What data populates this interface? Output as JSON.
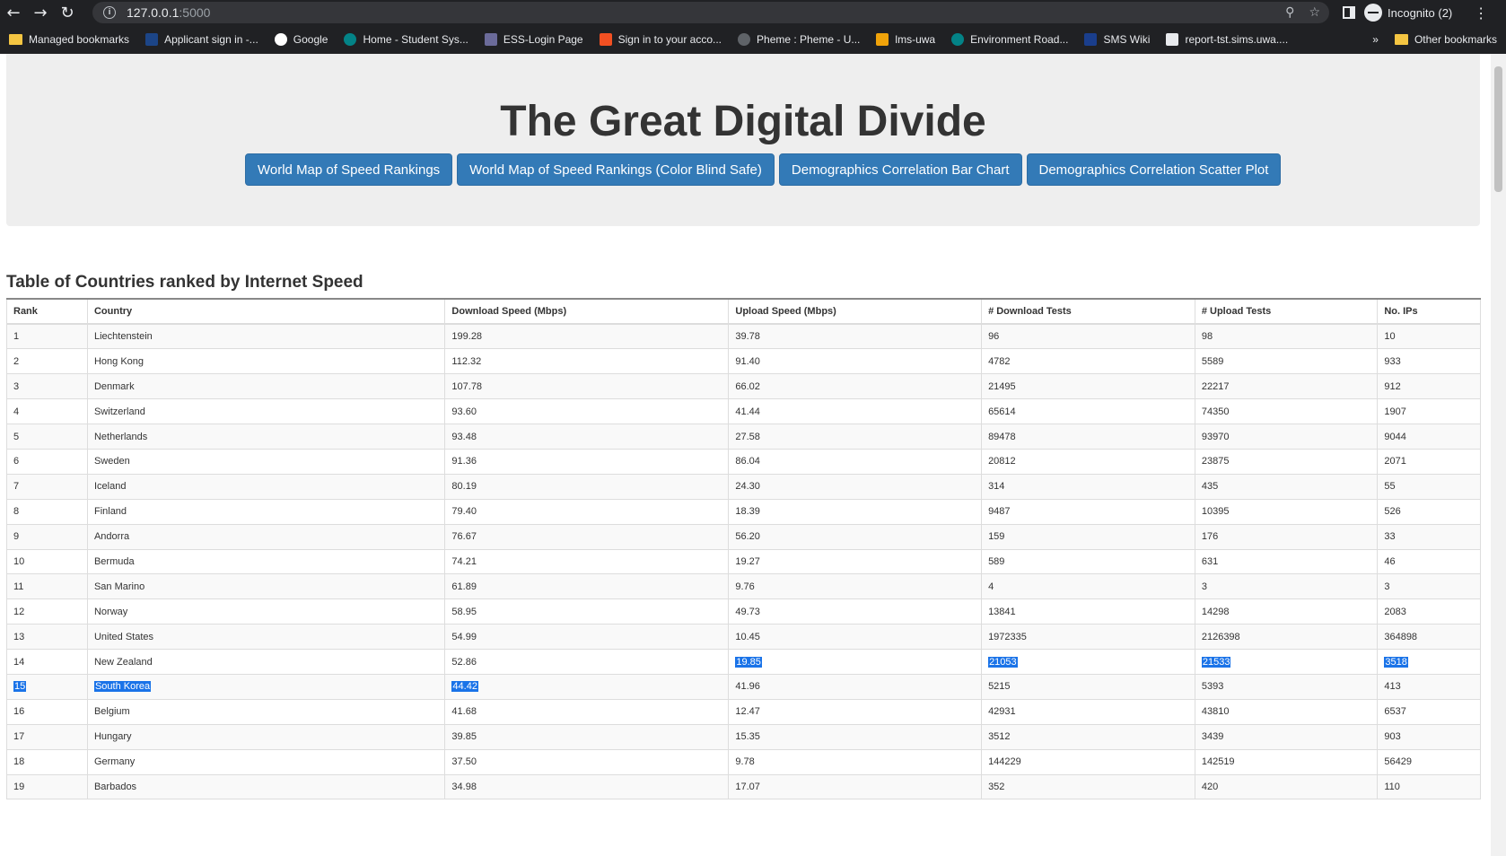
{
  "browser": {
    "url_host": "127.0.0.1",
    "url_port": ":5000",
    "profile_label": "Incognito (2)",
    "bookmarks": [
      {
        "label": "Managed bookmarks",
        "icon": "folder-icon",
        "color": "#f4c542"
      },
      {
        "label": "Applicant sign in -...",
        "icon": "applicant-icon",
        "color": "#1c4587"
      },
      {
        "label": "Google",
        "icon": "google-icon",
        "color": "#ffffff"
      },
      {
        "label": "Home - Student Sys...",
        "icon": "sharepoint-icon",
        "color": "#038387"
      },
      {
        "label": "ESS-Login Page",
        "icon": "ess-icon",
        "color": "#6b6b9a"
      },
      {
        "label": "Sign in to your acco...",
        "icon": "microsoft-icon",
        "color": "#f25022"
      },
      {
        "label": "Pheme : Pheme - U...",
        "icon": "pheme-icon",
        "color": "#5f6368"
      },
      {
        "label": "lms-uwa",
        "icon": "lms-icon",
        "color": "#f0a30a"
      },
      {
        "label": "Environment Road...",
        "icon": "sharepoint-icon",
        "color": "#038387"
      },
      {
        "label": "SMS Wiki",
        "icon": "wiki-icon",
        "color": "#1a3e8c"
      },
      {
        "label": "report-tst.sims.uwa....",
        "icon": "report-icon",
        "color": "#e8eaed"
      }
    ],
    "other_bookmarks": "Other bookmarks",
    "overflow_glyph": "»"
  },
  "header": {
    "title": "The Great Digital Divide",
    "buttons": [
      "World Map of Speed Rankings",
      "World Map of Speed Rankings (Color Blind Safe)",
      "Demographics Correlation Bar Chart",
      "Demographics Correlation Scatter Plot"
    ]
  },
  "table": {
    "caption": "Table of Countries ranked by Internet Speed",
    "columns": [
      "Rank",
      "Country",
      "Download Speed (Mbps)",
      "Upload Speed (Mbps)",
      "# Download Tests",
      "# Upload Tests",
      "No. IPs"
    ],
    "rows": [
      [
        "1",
        "Liechtenstein",
        "199.28",
        "39.78",
        "96",
        "98",
        "10"
      ],
      [
        "2",
        "Hong Kong",
        "112.32",
        "91.40",
        "4782",
        "5589",
        "933"
      ],
      [
        "3",
        "Denmark",
        "107.78",
        "66.02",
        "21495",
        "22217",
        "912"
      ],
      [
        "4",
        "Switzerland",
        "93.60",
        "41.44",
        "65614",
        "74350",
        "1907"
      ],
      [
        "5",
        "Netherlands",
        "93.48",
        "27.58",
        "89478",
        "93970",
        "9044"
      ],
      [
        "6",
        "Sweden",
        "91.36",
        "86.04",
        "20812",
        "23875",
        "2071"
      ],
      [
        "7",
        "Iceland",
        "80.19",
        "24.30",
        "314",
        "435",
        "55"
      ],
      [
        "8",
        "Finland",
        "79.40",
        "18.39",
        "9487",
        "10395",
        "526"
      ],
      [
        "9",
        "Andorra",
        "76.67",
        "56.20",
        "159",
        "176",
        "33"
      ],
      [
        "10",
        "Bermuda",
        "74.21",
        "19.27",
        "589",
        "631",
        "46"
      ],
      [
        "11",
        "San Marino",
        "61.89",
        "9.76",
        "4",
        "3",
        "3"
      ],
      [
        "12",
        "Norway",
        "58.95",
        "49.73",
        "13841",
        "14298",
        "2083"
      ],
      [
        "13",
        "United States",
        "54.99",
        "10.45",
        "1972335",
        "2126398",
        "364898"
      ],
      [
        "14",
        "New Zealand",
        "52.86",
        "19.85",
        "21053",
        "21533",
        "3518"
      ],
      [
        "15",
        "South Korea",
        "44.42",
        "41.96",
        "5215",
        "5393",
        "413"
      ],
      [
        "16",
        "Belgium",
        "41.68",
        "12.47",
        "42931",
        "43810",
        "6537"
      ],
      [
        "17",
        "Hungary",
        "39.85",
        "15.35",
        "3512",
        "3439",
        "903"
      ],
      [
        "18",
        "Germany",
        "37.50",
        "9.78",
        "144229",
        "142519",
        "56429"
      ],
      [
        "19",
        "Barbados",
        "34.98",
        "17.07",
        "352",
        "420",
        "110"
      ]
    ],
    "selected_cells": [
      [
        13,
        3
      ],
      [
        13,
        4
      ],
      [
        13,
        5
      ],
      [
        13,
        6
      ],
      [
        14,
        0
      ],
      [
        14,
        1
      ],
      [
        14,
        2
      ]
    ]
  },
  "colors": {
    "button_blue": "#337ab7",
    "selection": "#1a73e8",
    "jumbotron": "#eeeeee"
  }
}
